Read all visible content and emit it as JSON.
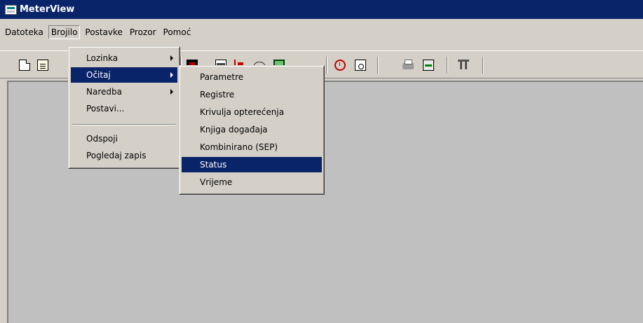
{
  "window": {
    "title": "MeterView"
  },
  "menubar": [
    "Datoteka",
    "Brojilo",
    "Postavke",
    "Prozor",
    "Pomoć"
  ],
  "brojilo_menu": {
    "items": [
      {
        "label": "Lozinka",
        "submenu": true
      },
      {
        "label": "Očitaj",
        "submenu": true,
        "highlighted": true
      },
      {
        "label": "Naredba",
        "submenu": true
      },
      {
        "label": "Postavi...",
        "submenu": false
      },
      {
        "label": "Odspoji",
        "submenu": false
      },
      {
        "label": "Pogledaj zapis",
        "submenu": false
      }
    ]
  },
  "ocitaj_submenu": {
    "items": [
      {
        "label": "Parametre"
      },
      {
        "label": "Registre"
      },
      {
        "label": "Krivulja opterećenja"
      },
      {
        "label": "Knjiga događaja"
      },
      {
        "label": "Kombinirano (SEP)"
      },
      {
        "label": "Status",
        "highlighted": true
      },
      {
        "label": "Vrijeme"
      }
    ]
  },
  "toolbar": {
    "icons": [
      "new-document-icon",
      "open-document-icon",
      "meter-icon",
      "ioe-icon",
      "load-profile-icon",
      "cloud-icon",
      "monitor-icon",
      "clock-icon",
      "clock-document-icon",
      "printer-icon",
      "transfer-icon",
      "wrench-icon"
    ]
  },
  "colors": {
    "title_bar": "#0a246a",
    "highlight": "#0a246a",
    "face": "#d4d0c8",
    "client": "#c0c0c0"
  }
}
